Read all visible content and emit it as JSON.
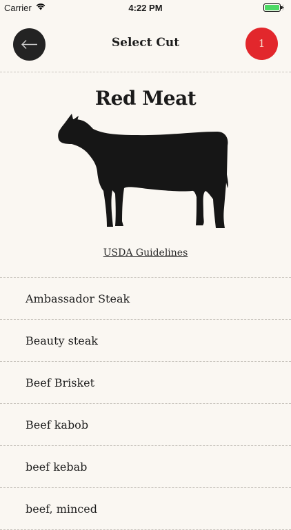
{
  "status": {
    "carrier": "Carrier",
    "time": "4:22 PM",
    "battery_color": "#4cd964"
  },
  "nav": {
    "title": "Select Cut",
    "back_icon": "arrow-left-icon",
    "cart_count": "1",
    "cart_color": "#e2272c"
  },
  "hero": {
    "title": "Red Meat",
    "image": "cow-silhouette",
    "link": "USDA Guidelines"
  },
  "cuts": [
    {
      "label": "Ambassador Steak"
    },
    {
      "label": "Beauty steak"
    },
    {
      "label": "Beef Brisket"
    },
    {
      "label": "Beef kabob"
    },
    {
      "label": "beef kebab"
    },
    {
      "label": "beef, minced"
    }
  ]
}
